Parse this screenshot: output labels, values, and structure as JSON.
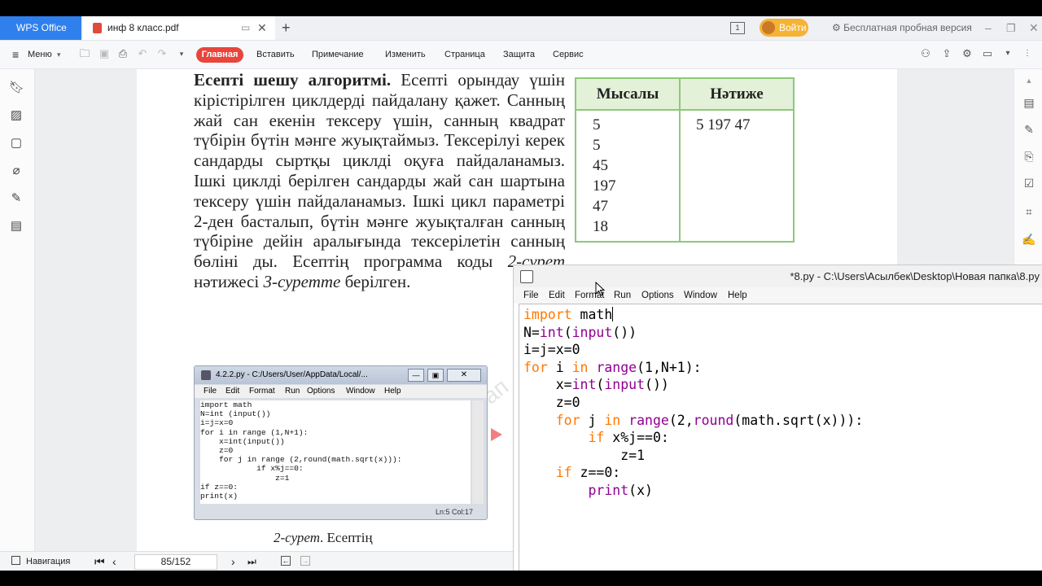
{
  "tabs": {
    "app_label": "WPS Office",
    "doc_title": "инф 8 класс.pdf",
    "login": "Войти",
    "trial": "Бесплатная пробная версия"
  },
  "menu": {
    "menu_label": "Меню",
    "items": [
      "Главная",
      "Вставить",
      "Примечание",
      "Изменить",
      "Страница",
      "Защита",
      "Сервис"
    ]
  },
  "book": {
    "paragraph_bold": "Есепті шешу алгоритмі.",
    "paragraph_rest": " Есепті орындау үшін кірістірілген циклдерді пайдалану қажет. Санның жай сан екенін тексеру үшін, санның квадрат түбірін бүтін мәнге жуықтаймыз. Тексерілуі керек сандарды сыртқы циклді оқуға пайдаланамыз. Ішкі циклді берілген сандарды жай сан шартына тексеру үшін пайдаланамыз. Ішкі цикл параметрі 2-ден басталып, бүтін мәнге жуықталған санның түбіріне дейін аралығында тексерілетін санның бөліні ды. Есептің программа коды ",
    "ref1": "2-сурет",
    "mid": " нәтижесі ",
    "ref2": "3-суретте",
    "end": " берілген.",
    "caption_italic": "2-сурет",
    "caption_rest": ". Есептің",
    "watermark": "Алматыкітап"
  },
  "table": {
    "col1_header": "Мысалы",
    "col2_header": "Нәтиже",
    "col1_values": [
      "5",
      "5",
      "45",
      "197",
      "47",
      "18"
    ],
    "col2_values": [
      "5 197 47"
    ]
  },
  "mini_window": {
    "title": "4.2.2.py - C:/Users/User/AppData/Local/...",
    "menu": [
      "File",
      "Edit",
      "Format",
      "Run",
      "Options",
      "Window",
      "Help"
    ],
    "code": "import math\nN=int (input())\ni=j=x=0\nfor i in range (1,N+1):\n    x=int(input())\n    z=0\n    for j in range (2,round(math.sqrt(x))):\n            if x%j==0:\n                z=1\nif z==0:\nprint(x)",
    "status": "Ln:5  Col:17"
  },
  "statusbar": {
    "nav_label": "Навигация",
    "page": "85/152"
  },
  "idle": {
    "title": "*8.py - C:\\Users\\Асылбек\\Desktop\\Новая папка\\8.py",
    "menu": [
      "File",
      "Edit",
      "Format",
      "Run",
      "Options",
      "Window",
      "Help"
    ],
    "code_lines": [
      "import math",
      "N=int(input())",
      "i=j=x=0",
      "for i in range(1,N+1):",
      "    x=int(input())",
      "    z=0",
      "    for j in range(2,round(math.sqrt(x))):",
      "        if x%j==0:",
      "            z=1",
      "    if z==0:",
      "        print(x)"
    ]
  }
}
